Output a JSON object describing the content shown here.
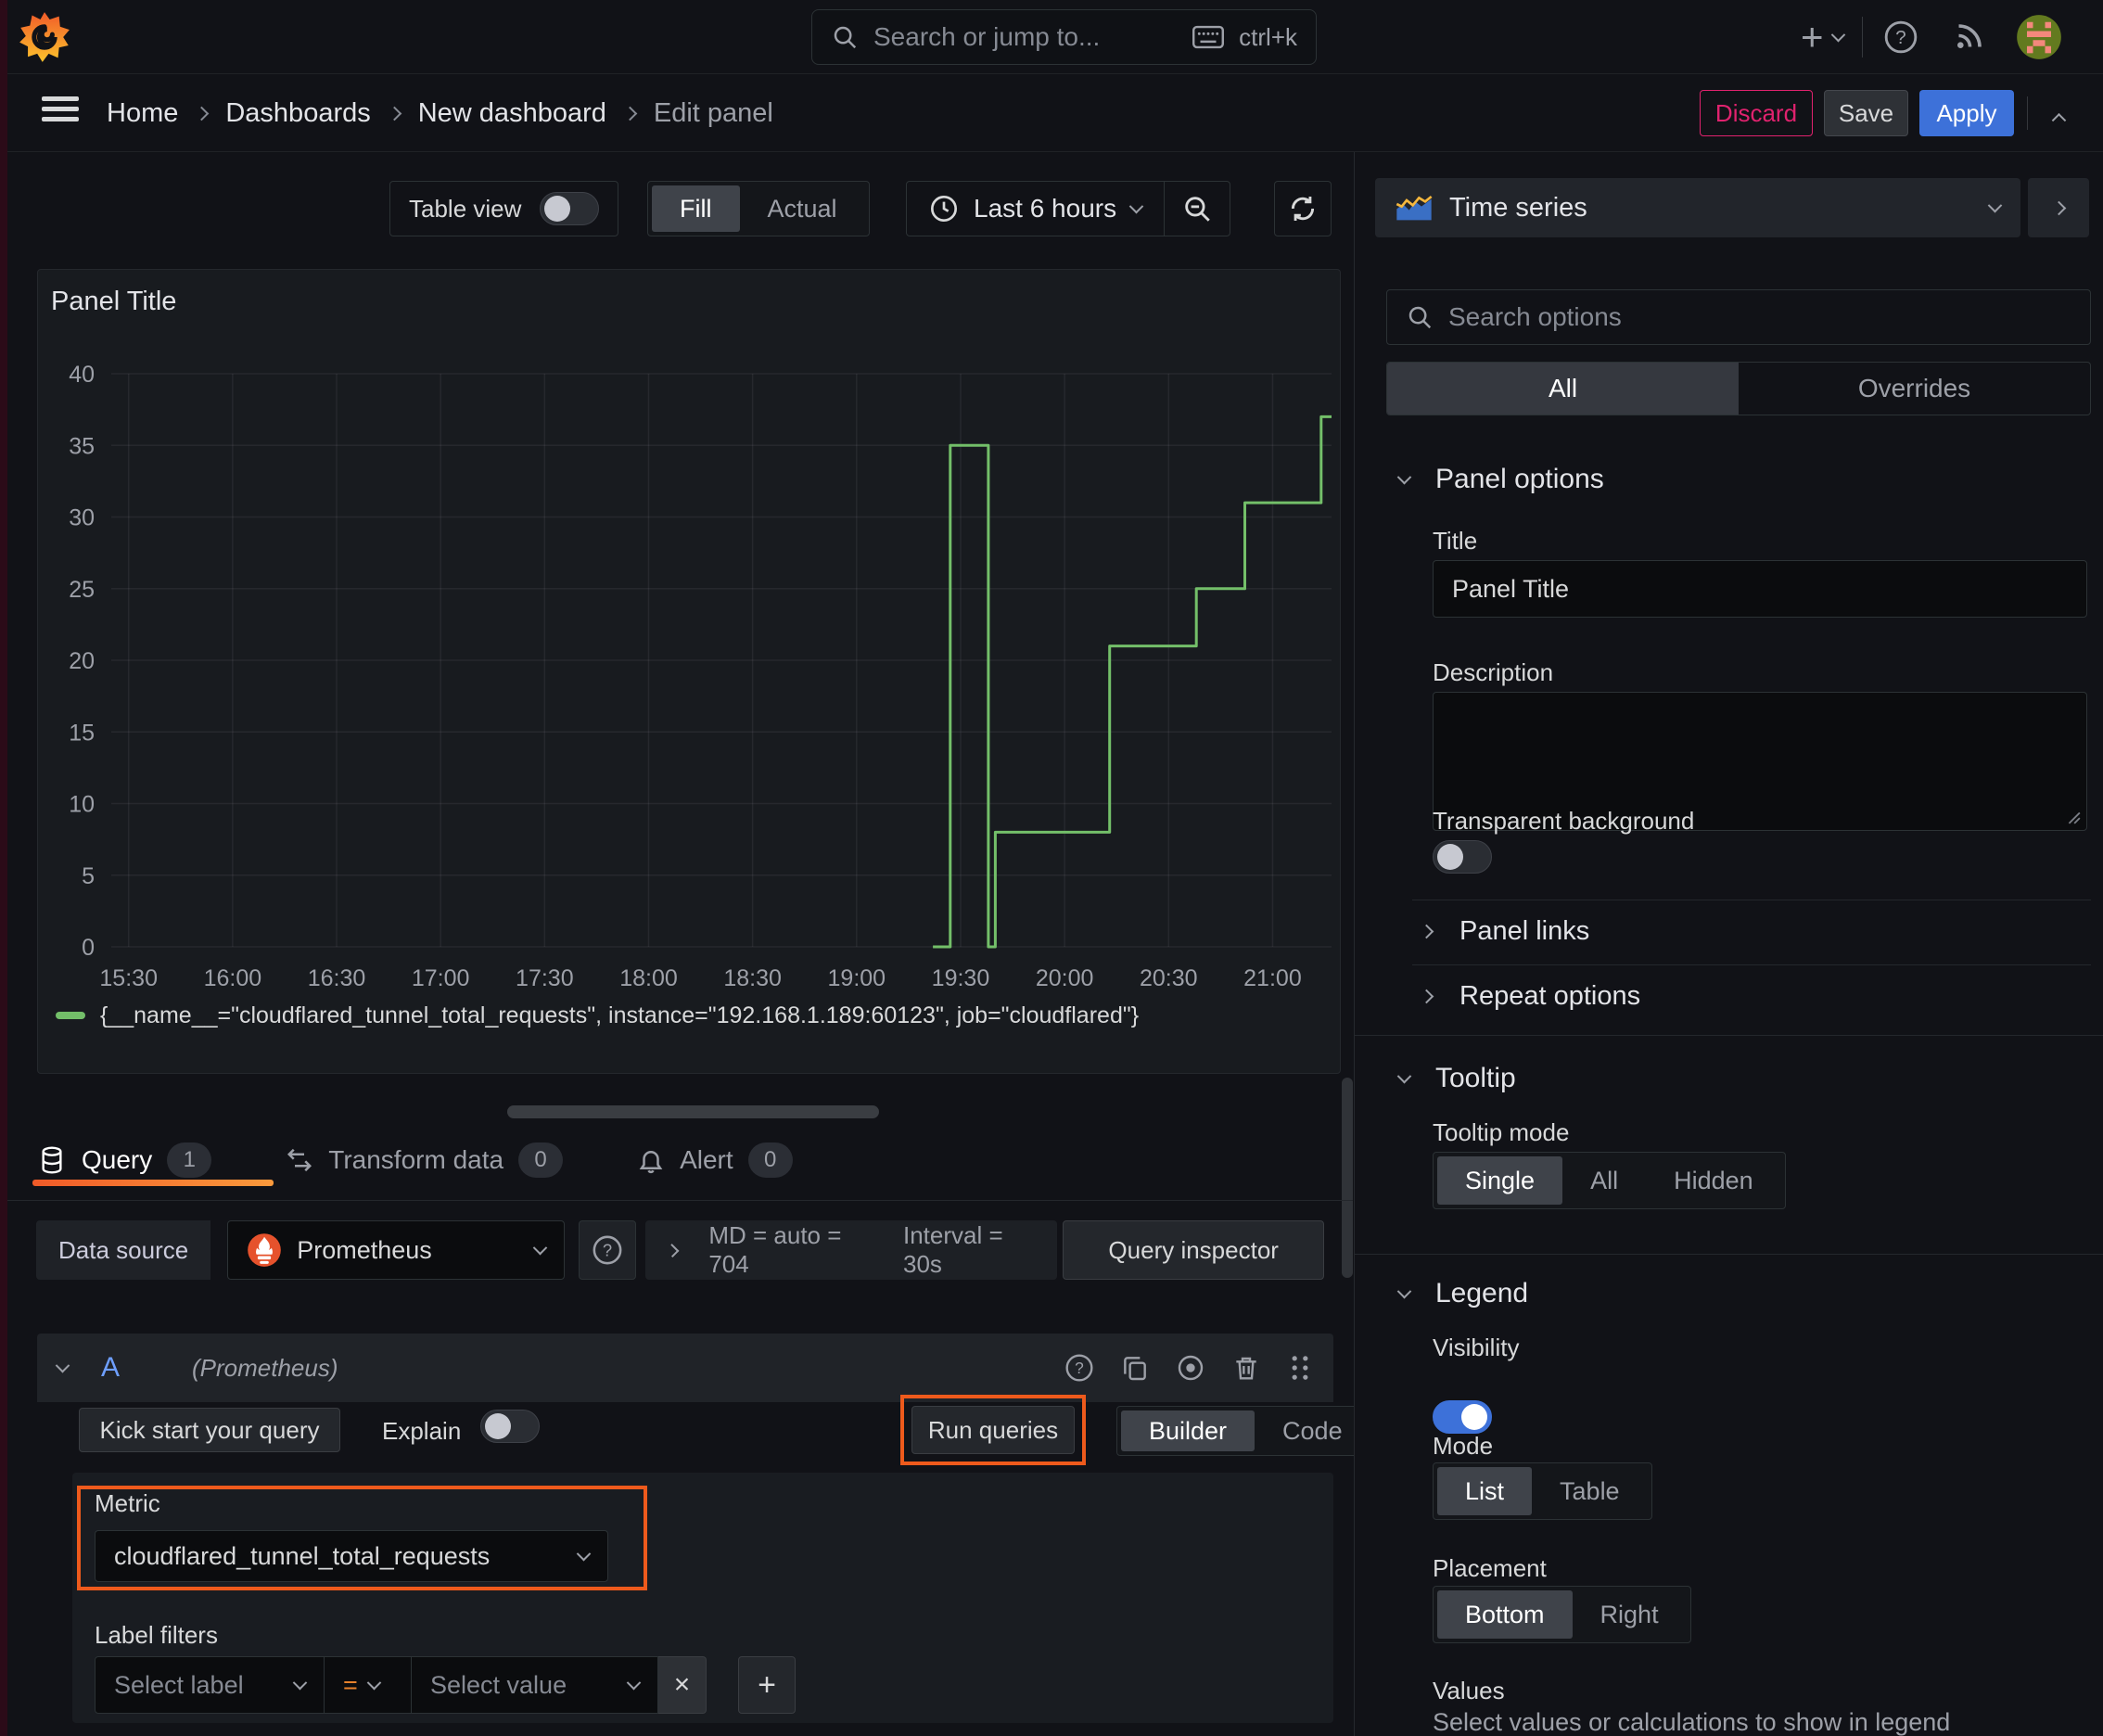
{
  "topbar": {
    "search_placeholder": "Search or jump to...",
    "shortcut": "ctrl+k"
  },
  "breadcrumb": {
    "items": [
      "Home",
      "Dashboards",
      "New dashboard",
      "Edit panel"
    ]
  },
  "actions": {
    "discard": "Discard",
    "save": "Save",
    "apply": "Apply"
  },
  "toolbar": {
    "table_view": "Table view",
    "fill": "Fill",
    "actual": "Actual",
    "time_range": "Last 6 hours"
  },
  "panel": {
    "title": "Panel Title"
  },
  "chart_data": {
    "type": "line",
    "line_interpolation": "step-after",
    "title": "Panel Title",
    "x_ticks": [
      "15:30",
      "16:00",
      "16:30",
      "17:00",
      "17:30",
      "18:00",
      "18:30",
      "19:00",
      "19:30",
      "20:00",
      "20:30",
      "21:00"
    ],
    "y_ticks": [
      0,
      5,
      10,
      15,
      20,
      25,
      30,
      35,
      40
    ],
    "x_range": [
      "15:25",
      "21:17"
    ],
    "ylim": [
      0,
      40
    ],
    "grid": true,
    "legend_position": "bottom",
    "series": [
      {
        "name": "{__name__=\"cloudflared_tunnel_total_requests\", instance=\"192.168.1.189:60123\", job=\"cloudflared\"}",
        "color": "#73BF69",
        "points": [
          [
            "19:22",
            0
          ],
          [
            "19:27",
            35
          ],
          [
            "19:38",
            0
          ],
          [
            "19:40",
            8
          ],
          [
            "20:13",
            21
          ],
          [
            "20:38",
            25
          ],
          [
            "20:52",
            31
          ],
          [
            "21:14",
            37
          ]
        ]
      }
    ]
  },
  "tabs": {
    "query": "Query",
    "query_count": "1",
    "transform": "Transform data",
    "transform_count": "0",
    "alert": "Alert",
    "alert_count": "0"
  },
  "datasource": {
    "label": "Data source",
    "name": "Prometheus",
    "stats": "MD = auto = 704",
    "interval": "Interval = 30s",
    "inspector": "Query inspector"
  },
  "query_row": {
    "letter": "A",
    "source": "(Prometheus)"
  },
  "editor": {
    "kickstart": "Kick start your query",
    "explain": "Explain",
    "run": "Run queries",
    "builder": "Builder",
    "code": "Code",
    "metric_label": "Metric",
    "metric_value": "cloudflared_tunnel_total_requests",
    "filters_label": "Label filters",
    "select_label": "Select label",
    "op": "=",
    "select_value": "Select value",
    "remove_filter": "×",
    "add_filter": "+"
  },
  "sidebar": {
    "viz": "Time series",
    "search_placeholder": "Search options",
    "tab_all": "All",
    "tab_overrides": "Overrides",
    "panel_options": {
      "heading": "Panel options",
      "title_label": "Title",
      "title_value": "Panel Title",
      "desc_label": "Description",
      "transparent": "Transparent background"
    },
    "links": "Panel links",
    "repeat": "Repeat options",
    "tooltip": {
      "heading": "Tooltip",
      "mode_label": "Tooltip mode",
      "modes": [
        "Single",
        "All",
        "Hidden"
      ]
    },
    "legend": {
      "heading": "Legend",
      "visibility": "Visibility",
      "mode_label": "Mode",
      "modes": [
        "List",
        "Table"
      ],
      "placement_label": "Placement",
      "placements": [
        "Bottom",
        "Right"
      ],
      "values_label": "Values",
      "values_help": "Select values or calculations to show in legend"
    }
  },
  "icons": [
    "grafana-logo",
    "search-icon",
    "keyboard-icon",
    "plus-icon",
    "help-icon",
    "rss-icon",
    "avatar",
    "menu-icon",
    "clock-icon",
    "zoom-out-icon",
    "refresh-icon",
    "timeseries-icon",
    "database-icon",
    "transform-icon",
    "bell-icon",
    "prometheus-icon",
    "copy-icon",
    "eye-icon",
    "trash-icon",
    "drag-icon"
  ],
  "colors": {
    "annotation_orange": "#ee5a1c",
    "series_green": "#73BF69",
    "apply_blue": "#3d71d9",
    "discard_pink": "#e0226e",
    "background": "#111217",
    "panel_background": "#181b1f"
  }
}
